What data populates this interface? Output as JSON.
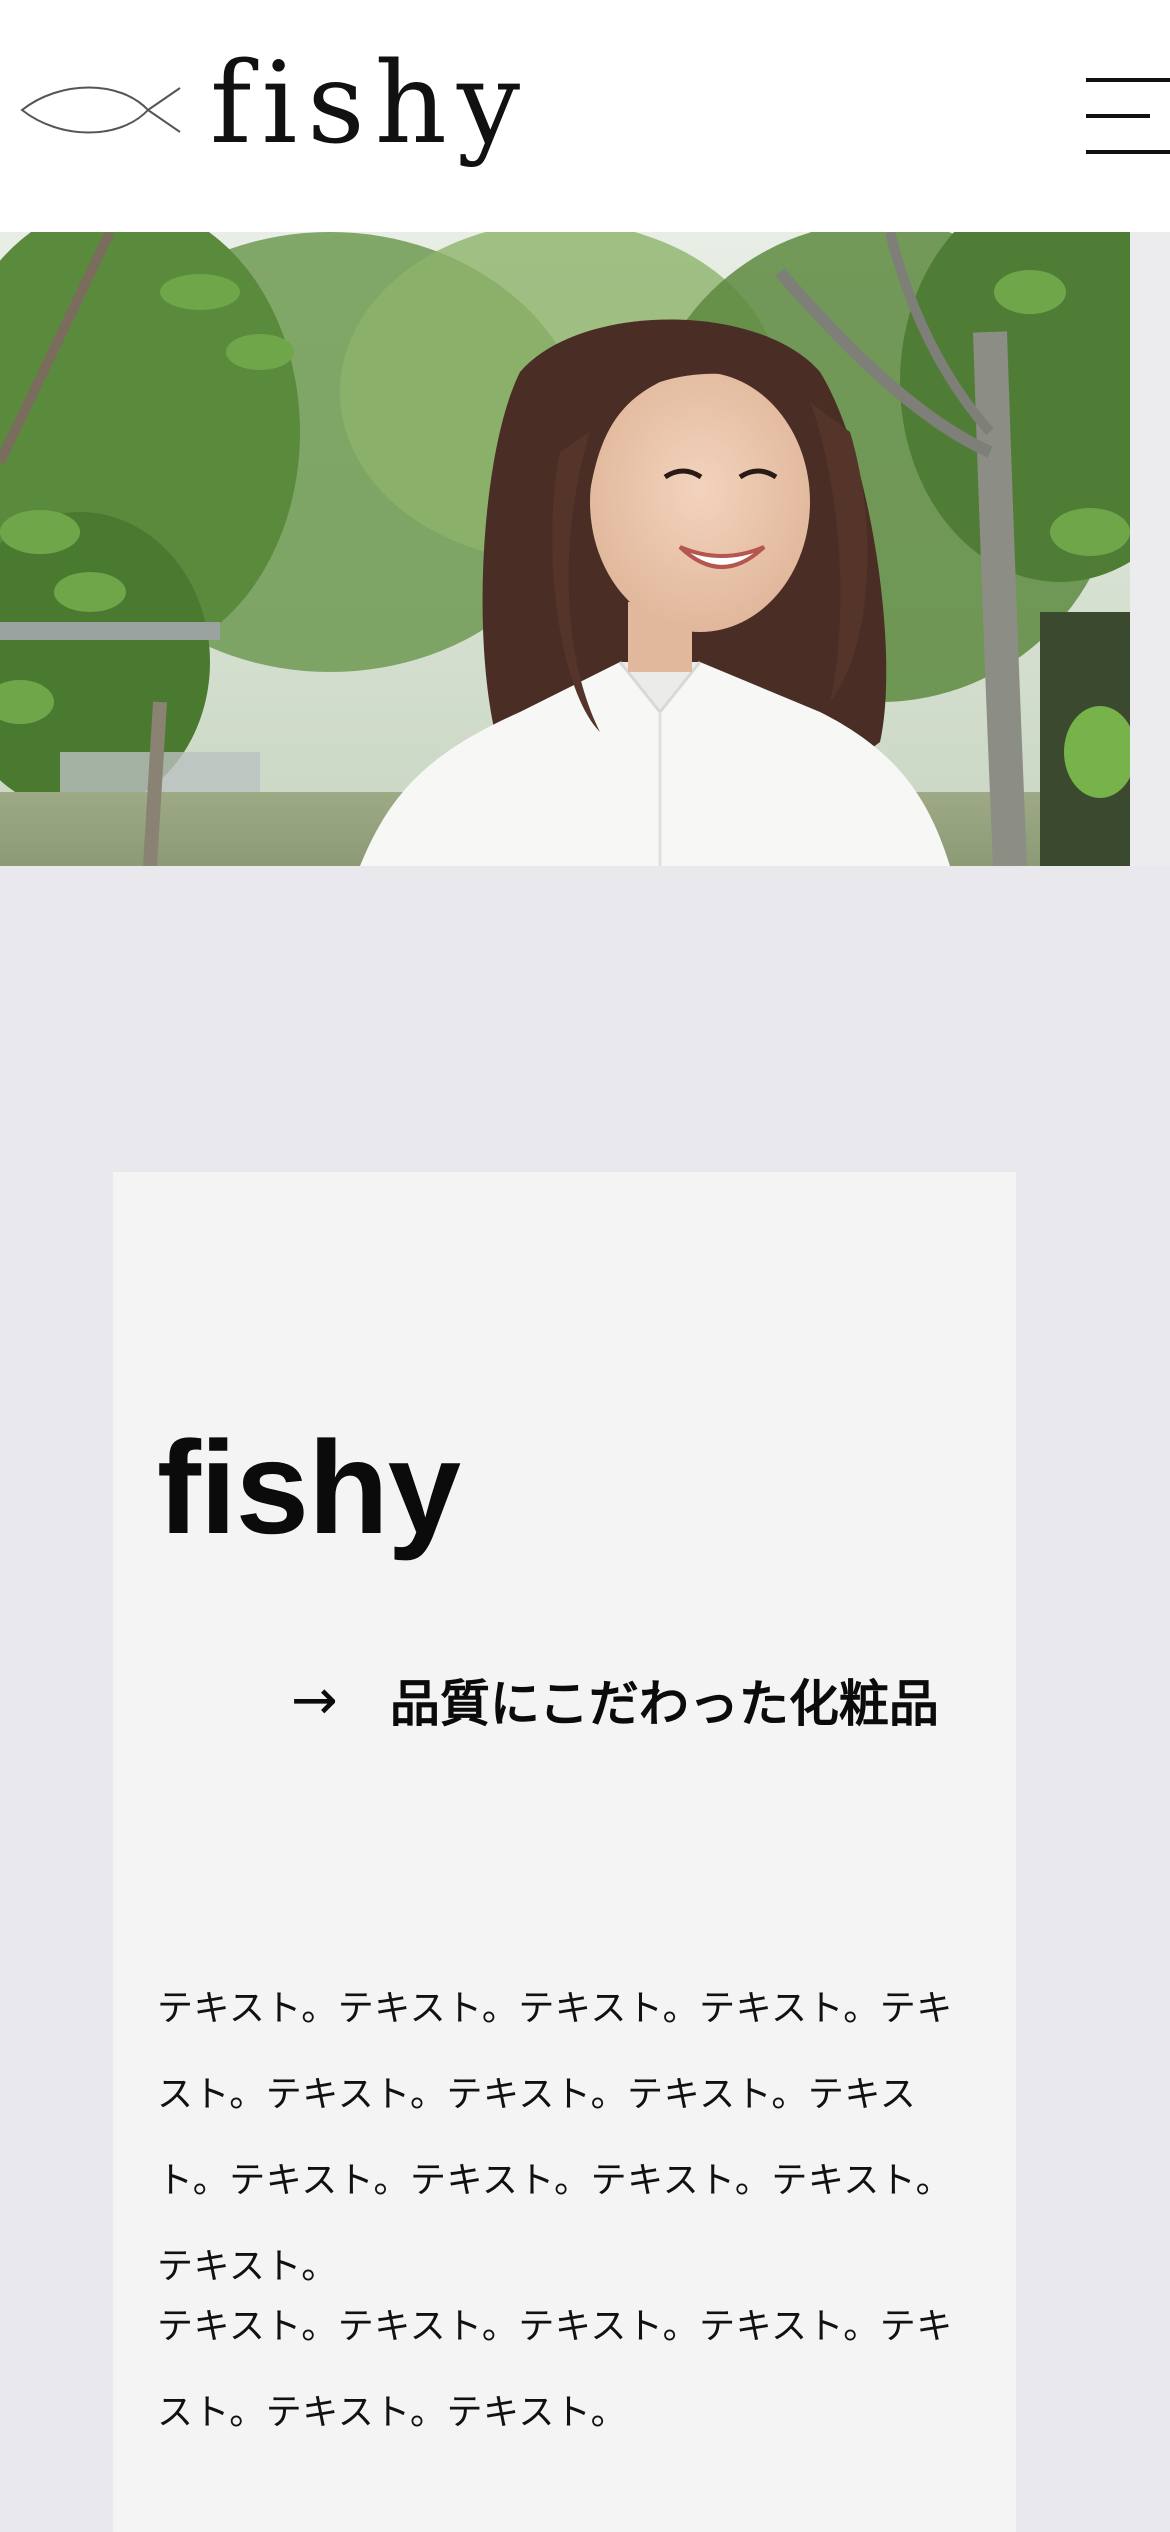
{
  "header": {
    "logo_text": "fishy",
    "logo_icon": "fish-outline-icon",
    "menu_icon": "hamburger-menu-icon"
  },
  "hero": {
    "image": "photo-smiling-woman-white-shirt-trees"
  },
  "content": {
    "title": "fishy",
    "tagline_arrow": "→",
    "tagline": "品質にこだわった化粧品",
    "paragraphs": [
      "テキスト。テキスト。テキスト。テキスト。テキスト。テキスト。テキスト。テキスト。テキスト。テキスト。テキスト。テキスト。テキスト。テキスト。",
      "テキスト。テキスト。テキスト。テキスト。テキスト。テキスト。テキスト。"
    ]
  },
  "colors": {
    "page_background": "#e9e8ec",
    "card_background": "#f4f4f5",
    "header_background": "#ffffff",
    "text": "#111111"
  }
}
